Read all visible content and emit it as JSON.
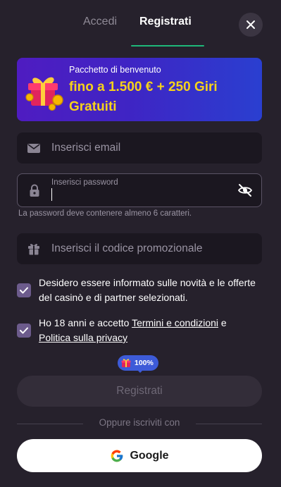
{
  "tabs": {
    "login": "Accedi",
    "register": "Registrati",
    "active": "register"
  },
  "banner": {
    "subtitle": "Pacchetto di benvenuto",
    "title": "fino a 1.500 € + 250 Giri Gratuiti"
  },
  "form": {
    "email_placeholder": "Inserisci email",
    "password_label": "Inserisci password",
    "password_hint": "La password deve contenere almeno 6 caratteri.",
    "promo_placeholder": "Inserisci il codice promozionale"
  },
  "consents": {
    "marketing_text": "Desidero essere informato sulle novità e le offerte del casinò e di partner selezionati.",
    "marketing_checked": true,
    "terms_prefix": "Ho 18 anni e accetto ",
    "terms_link": "Termini e condizioni",
    "terms_and": " e ",
    "privacy_link": "Politica sulla privacy",
    "terms_checked": true
  },
  "badge": {
    "text": "100%"
  },
  "submit_label": "Registrati",
  "divider_text": "Oppure iscriviti con",
  "google_label": "Google",
  "colors": {
    "accent": "#1fb87a",
    "banner_text": "#f6d21a",
    "checkbox": "#6c5b8c",
    "badge": "#3d5bd8"
  },
  "icons": [
    "close-icon",
    "gift-icon",
    "mail-icon",
    "lock-icon",
    "eye-off-icon",
    "gift-box-icon",
    "check-icon",
    "google-icon"
  ]
}
